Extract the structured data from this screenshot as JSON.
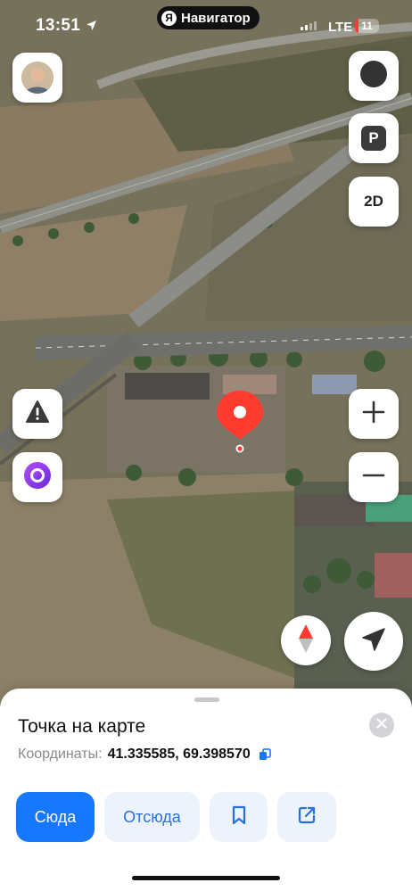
{
  "status_bar": {
    "time": "13:51",
    "app_name": "Навигатор",
    "app_logo": "Я",
    "network": "LTE",
    "battery": "11"
  },
  "map": {
    "view_mode": "2D",
    "parking_label": "P",
    "icons": {
      "layers": "layers-icon",
      "alert": "road-alert-icon",
      "alice": "alice-assistant-icon",
      "zoom_in": "plus-icon",
      "zoom_out": "minus-icon",
      "compass": "compass-icon",
      "locate": "location-arrow-icon"
    },
    "pin_color": "#ff3b30"
  },
  "sheet": {
    "title": "Точка на карте",
    "coords_label": "Координаты:",
    "coords_value": "41.335585, 69.398570",
    "actions": {
      "here": "Сюда",
      "from": "Отсюда"
    }
  },
  "colors": {
    "accent": "#1677ff",
    "secondary_bg": "#edf3fb",
    "pin": "#ff3b30"
  }
}
